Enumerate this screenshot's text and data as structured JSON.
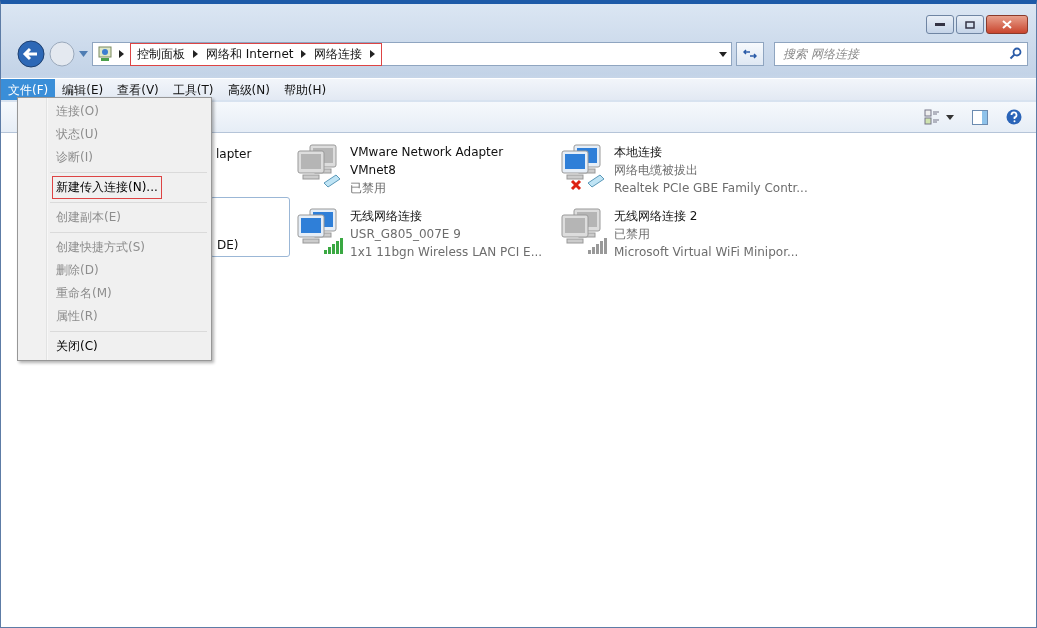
{
  "address_bar": {
    "breadcrumbs": [
      "控制面板",
      "网络和 Internet",
      "网络连接"
    ],
    "annotated": true
  },
  "search": {
    "placeholder": "搜索 网络连接"
  },
  "menu_bar": [
    {
      "label": "文件(F)",
      "selected": true
    },
    {
      "label": "编辑(E)",
      "selected": false
    },
    {
      "label": "查看(V)",
      "selected": false
    },
    {
      "label": "工具(T)",
      "selected": false
    },
    {
      "label": "高级(N)",
      "selected": false
    },
    {
      "label": "帮助(H)",
      "selected": false
    }
  ],
  "file_menu": [
    {
      "label": "连接(O)",
      "disabled": true,
      "separator_after": false,
      "annotated": false
    },
    {
      "label": "状态(U)",
      "disabled": true,
      "separator_after": false,
      "annotated": false
    },
    {
      "label": "诊断(I)",
      "disabled": true,
      "separator_after": true,
      "annotated": false
    },
    {
      "label": "新建传入连接(N)...",
      "disabled": false,
      "separator_after": true,
      "annotated": true
    },
    {
      "label": "创建副本(E)",
      "disabled": true,
      "separator_after": true,
      "annotated": false
    },
    {
      "label": "创建快捷方式(S)",
      "disabled": true,
      "separator_after": false,
      "annotated": false
    },
    {
      "label": "删除(D)",
      "disabled": true,
      "separator_after": false,
      "annotated": false
    },
    {
      "label": "重命名(M)",
      "disabled": true,
      "separator_after": false,
      "annotated": false
    },
    {
      "label": "属性(R)",
      "disabled": true,
      "separator_after": true,
      "annotated": false
    },
    {
      "label": "关闭(C)",
      "disabled": false,
      "separator_after": false,
      "annotated": false
    }
  ],
  "hidden_items": [
    {
      "text": "lapter",
      "selected": false
    },
    {
      "text": "DE)",
      "selected": true
    }
  ],
  "connections": [
    {
      "name": "VMware Network Adapter VMnet8",
      "status": "已禁用",
      "kind": "wired",
      "disabled": true,
      "unplugged": false
    },
    {
      "name": "本地连接",
      "status": "网络电缆被拔出",
      "device": "Realtek PCIe GBE Family Contr...",
      "kind": "wired",
      "disabled": false,
      "unplugged": true
    },
    {
      "name": "无线网络连接",
      "status": "USR_G805_007E  9",
      "device": "1x1 11bgn Wireless LAN PCI E...",
      "kind": "wireless",
      "disabled": false,
      "unplugged": false
    },
    {
      "name": "无线网络连接 2",
      "status": "已禁用",
      "device": "Microsoft Virtual WiFi Minipor...",
      "kind": "wireless",
      "disabled": true,
      "unplugged": false
    }
  ]
}
